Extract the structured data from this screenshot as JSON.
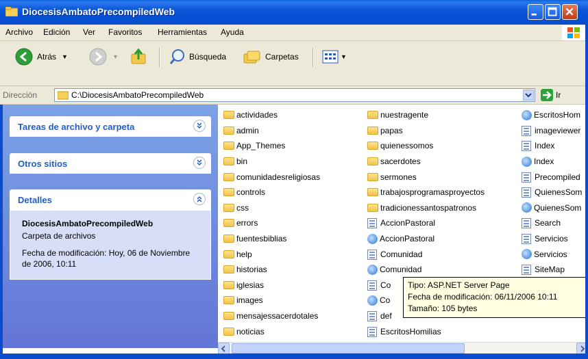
{
  "window": {
    "title": "DiocesisAmbatoPrecompiledWeb"
  },
  "menu": [
    "Archivo",
    "Edición",
    "Ver",
    "Favoritos",
    "Herramientas",
    "Ayuda"
  ],
  "toolbar": {
    "back_label": "Atrás",
    "search_label": "Búsqueda",
    "folders_label": "Carpetas"
  },
  "address": {
    "label": "Dirección",
    "value": "C:\\DiocesisAmbatoPrecompiledWeb",
    "go_label": "Ir"
  },
  "taskpane": {
    "panel1": "Tareas de archivo y carpeta",
    "panel2": "Otros sitios",
    "panel3": "Detalles",
    "details": {
      "name": "DiocesisAmbatoPrecompiledWeb",
      "type": "Carpeta de archivos",
      "modified": "Fecha de modificación: Hoy, 06 de Noviembre de 2006, 10:11"
    }
  },
  "files": {
    "col1": [
      "actividades",
      "admin",
      "App_Themes",
      "bin",
      "comunidadesreligiosas",
      "controls",
      "css",
      "errors",
      "fuentesbiblias",
      "help",
      "historias",
      "iglesias",
      "images",
      "mensajessacerdotales",
      "noticias"
    ],
    "col2": [
      {
        "name": "nuestragente",
        "kind": "folder"
      },
      {
        "name": "papas",
        "kind": "folder"
      },
      {
        "name": "quienessomos",
        "kind": "folder"
      },
      {
        "name": "sacerdotes",
        "kind": "folder"
      },
      {
        "name": "sermones",
        "kind": "folder"
      },
      {
        "name": "trabajosprogramasproyectos",
        "kind": "folder"
      },
      {
        "name": "tradicionessantospatronos",
        "kind": "folder"
      },
      {
        "name": "AccionPastoral",
        "kind": "doc"
      },
      {
        "name": "AccionPastoral",
        "kind": "ie"
      },
      {
        "name": "Comunidad",
        "kind": "doc"
      },
      {
        "name": "Comunidad",
        "kind": "ie"
      },
      {
        "name": "Co",
        "kind": "doc"
      },
      {
        "name": "Co",
        "kind": "ie"
      },
      {
        "name": "def",
        "kind": "doc"
      },
      {
        "name": "EscritosHomilias",
        "kind": "doc"
      }
    ],
    "col3": [
      {
        "name": "EscritosHom",
        "kind": "ie"
      },
      {
        "name": "imageviewer",
        "kind": "doc"
      },
      {
        "name": "Index",
        "kind": "doc"
      },
      {
        "name": "Index",
        "kind": "ie"
      },
      {
        "name": "Precompiled",
        "kind": "doc"
      },
      {
        "name": "QuienesSom",
        "kind": "doc"
      },
      {
        "name": "QuienesSom",
        "kind": "ie"
      },
      {
        "name": "Search",
        "kind": "doc"
      },
      {
        "name": "Servicios",
        "kind": "doc"
      },
      {
        "name": "Servicios",
        "kind": "ie"
      },
      {
        "name": "SiteMap",
        "kind": "doc"
      }
    ]
  },
  "tooltip": {
    "line1": "Tipo: ASP.NET Server Page",
    "line2": "Fecha de modificación: 06/11/2006 10:11",
    "line3": "Tamaño: 105 bytes"
  }
}
